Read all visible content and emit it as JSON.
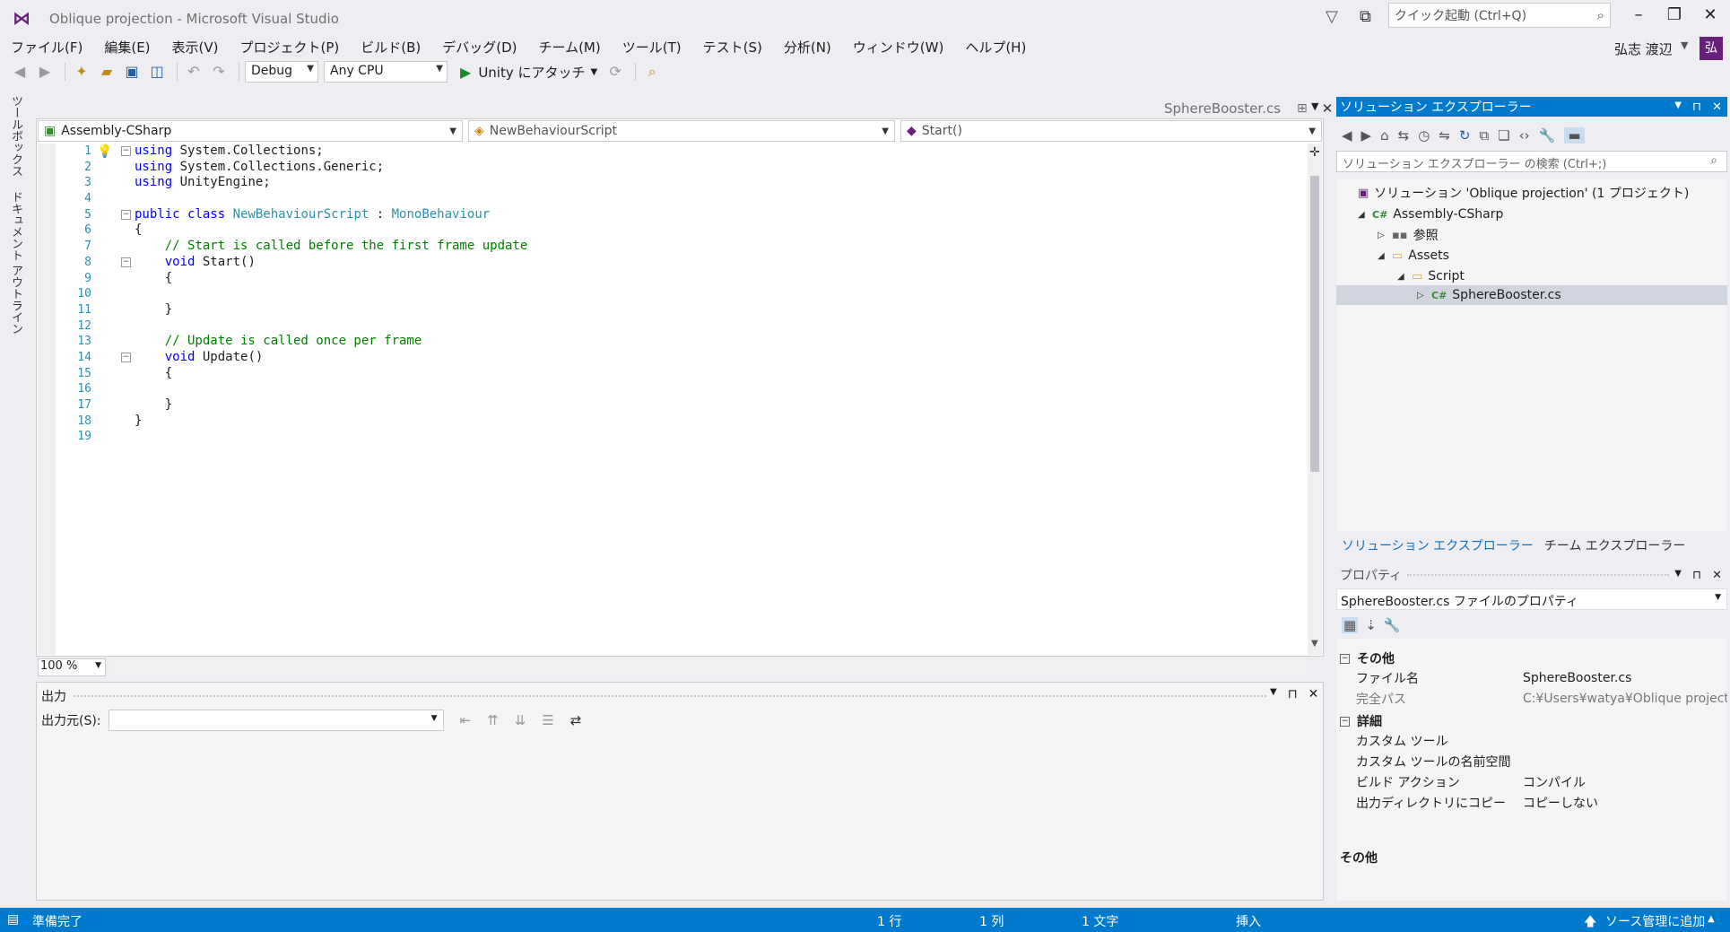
{
  "window": {
    "title": "Oblique projection - Microsoft Visual Studio",
    "quick_launch_placeholder": "クイック起動 (Ctrl+Q)",
    "user_name": "弘志 渡辺",
    "avatar_initial": "弘"
  },
  "menu": [
    "ファイル(F)",
    "編集(E)",
    "表示(V)",
    "プロジェクト(P)",
    "ビルド(B)",
    "デバッグ(D)",
    "チーム(M)",
    "ツール(T)",
    "テスト(S)",
    "分析(N)",
    "ウィンドウ(W)",
    "ヘルプ(H)"
  ],
  "toolbar": {
    "configuration": "Debug",
    "platform": "Any CPU",
    "attach_label": "Unity にアタッチ"
  },
  "side_tabs": [
    "ツールボックス",
    "ドキュメント アウトライン"
  ],
  "editor": {
    "tab_title": "SphereBooster.cs",
    "nav_project": "Assembly-CSharp",
    "nav_class": "NewBehaviourScript",
    "nav_member": "Start()",
    "zoom": "100 %",
    "line_numbers": [
      "1",
      "2",
      "3",
      "4",
      "5",
      "6",
      "7",
      "8",
      "9",
      "10",
      "11",
      "12",
      "13",
      "14",
      "15",
      "16",
      "17",
      "18",
      "19"
    ],
    "code": {
      "l1_kw": "using",
      "l1_rest": " System.Collections;",
      "l2_kw": "using",
      "l2_rest": " System.Collections.Generic;",
      "l3_kw": "using",
      "l3_rest": " UnityEngine;",
      "l5_kw": "public class",
      "l5_type": "NewBehaviourScript",
      "l5_colon": " : ",
      "l5_base": "MonoBehaviour",
      "l6": "{",
      "l7": "    // Start is called before the first frame update",
      "l8_kw": "    void",
      "l8_rest": " Start()",
      "l9": "    {",
      "l11": "    }",
      "l13": "    // Update is called once per frame",
      "l14_kw": "    void",
      "l14_rest": " Update()",
      "l15": "    {",
      "l17": "    }",
      "l18": "}"
    }
  },
  "output": {
    "title": "出力",
    "source_label": "出力元(S):",
    "source_value": ""
  },
  "solution_explorer": {
    "title": "ソリューション エクスプローラー",
    "search_placeholder": "ソリューション エクスプローラー の検索 (Ctrl+;)",
    "tree": {
      "solution": "ソリューション 'Oblique projection' (1 プロジェクト)",
      "project": "Assembly-CSharp",
      "references": "参照",
      "assets": "Assets",
      "script": "Script",
      "file": "SphereBooster.cs"
    },
    "tabs": [
      "ソリューション エクスプローラー",
      "チーム エクスプローラー"
    ]
  },
  "properties": {
    "title": "プロパティ",
    "object": "SphereBooster.cs ファイルのプロパティ",
    "cat_misc": "その他",
    "file_name_key": "ファイル名",
    "file_name_val": "SphereBooster.cs",
    "full_path_key": "完全パス",
    "full_path_val": "C:¥Users¥watya¥Oblique projecti",
    "cat_advanced": "詳細",
    "custom_tool_key": "カスタム ツール",
    "custom_tool_val": "",
    "custom_ns_key": "カスタム ツールの名前空間",
    "custom_ns_val": "",
    "build_action_key": "ビルド アクション",
    "build_action_val": "コンパイル",
    "copy_key": "出力ディレクトリにコピー",
    "copy_val": "コピーしない",
    "description_title": "その他"
  },
  "status": {
    "ready": "準備完了",
    "line": "1 行",
    "col": "1 列",
    "char": "1 文字",
    "mode": "挿入",
    "source_control": "ソース管理に追加"
  },
  "colors": {
    "accent": "#007acc",
    "keyword": "#0000ff",
    "type": "#2b91af",
    "comment": "#008000"
  }
}
